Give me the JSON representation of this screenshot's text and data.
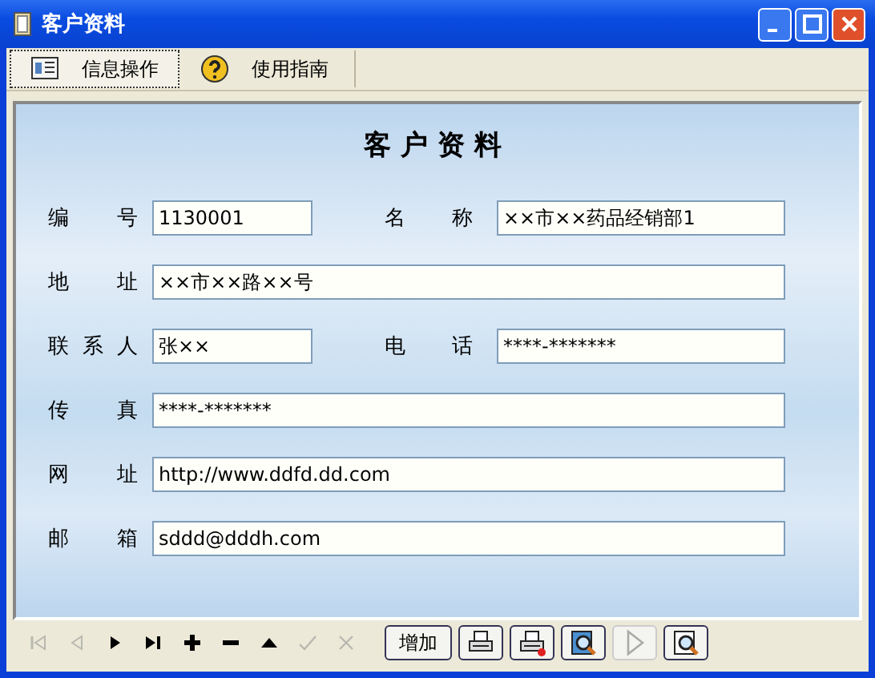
{
  "window": {
    "title": "客户资料"
  },
  "tabs": [
    {
      "label": "信息操作",
      "selected": true,
      "kind": "card"
    },
    {
      "label": "使用指南",
      "selected": false,
      "kind": "help"
    }
  ],
  "form": {
    "title": "客户资料",
    "rows": [
      {
        "fields": [
          {
            "label": "编号",
            "value": "1130001"
          },
          {
            "label": "名称",
            "value": "××市××药品经销部1"
          }
        ]
      },
      {
        "fields": [
          {
            "label": "地址",
            "value": "××市××路××号"
          }
        ]
      },
      {
        "fields": [
          {
            "label": "联系人",
            "value": "张××"
          },
          {
            "label": "电话",
            "value": "****-*******"
          }
        ]
      },
      {
        "fields": [
          {
            "label": "传真",
            "value": "****-*******"
          }
        ]
      },
      {
        "fields": [
          {
            "label": "网址",
            "value": "http://www.ddfd.dd.com"
          }
        ]
      },
      {
        "fields": [
          {
            "label": "邮箱",
            "value": "sddd@dddh.com"
          }
        ]
      }
    ]
  },
  "navigator": [
    {
      "kind": "first",
      "disabled": true
    },
    {
      "kind": "prev",
      "disabled": true
    },
    {
      "kind": "next",
      "disabled": false
    },
    {
      "kind": "last",
      "disabled": false
    },
    {
      "kind": "plus",
      "disabled": false
    },
    {
      "kind": "minus",
      "disabled": false
    },
    {
      "kind": "up",
      "disabled": false
    },
    {
      "kind": "check",
      "disabled": true
    },
    {
      "kind": "cancel",
      "disabled": true
    }
  ],
  "actions": [
    {
      "kind": "text",
      "label": "增加",
      "disabled": false
    },
    {
      "kind": "print",
      "disabled": false
    },
    {
      "kind": "print-red",
      "disabled": false
    },
    {
      "kind": "preview",
      "disabled": false
    },
    {
      "kind": "play",
      "disabled": true
    },
    {
      "kind": "find",
      "disabled": false
    }
  ]
}
